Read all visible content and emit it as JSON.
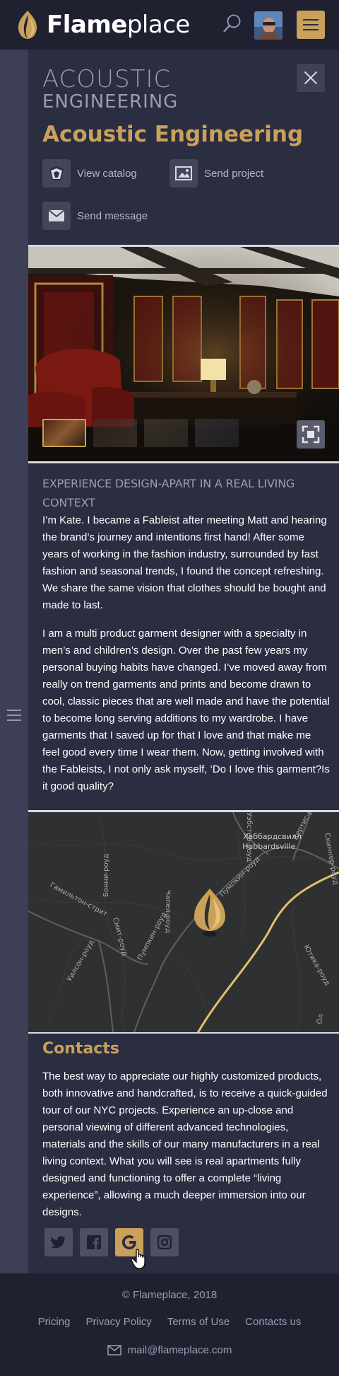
{
  "header": {
    "logo_bold": "Flame",
    "logo_light": "place"
  },
  "panel": {
    "kicker_line1": "ACOUSTIC",
    "kicker_line2": "ENGINEERING",
    "title": "Acoustic Engineering",
    "actions": {
      "catalog": "View catalog",
      "project": "Send project",
      "message": "Send message"
    }
  },
  "experience": {
    "heading": "EXPERIENCE DESIGN-APART IN A REAL LIVING CONTEXT",
    "paragraph1": "I’m Kate. I became a Fableist after meeting Matt and hearing the brand’s journey and intentions first hand! After some years of working in the fashion industry, surrounded by fast fashion and seasonal trends, I found the concept refreshing. We share the same vision that clothes should be bought and made to last.",
    "paragraph2": "I am a multi product garment designer with a specialty in men’s and children’s design. Over the past few years my personal buying habits have changed. I’ve moved away from really on trend garments and prints and become drawn to cool, classic pieces that are well made and have the potential to become long serving additions to my wardrobe. I have garments that I saved up for that I love and that make me feel good every time I wear them. Now, getting involved with the Fableists, I not only ask myself, ‘Do I love this garment?Is it good quality?"
  },
  "map": {
    "labels": {
      "place_ru": "Хаббардсвилл",
      "place_en": "Hubbardsville",
      "street_hamilton": "Гамильтон-стрит",
      "road_pumpkin1": "Пумпкин-роуд",
      "road_pumpkin2": "Пумпкин-роуд",
      "road_curtis": "Кертис-роуд",
      "road_bonnie": "Бонни-роуд",
      "road_smith": "Смит-роуд",
      "road_chapel": "Чапел-роуд",
      "road_wilson": "Уилсон-роуд",
      "road_utica": "Ютика-роуд",
      "road_webster": "Уэбстер-роуд",
      "road_cooper": "Купер",
      "road_skinner": "Скиннер-роуд",
      "road_edge": "Ол"
    }
  },
  "contacts": {
    "title": "Contacts",
    "text": "The best way to appreciate our highly customized products, both innovative and handcrafted, is to receive a quick-guided tour of our NYC projects. Experience an up-close and personal viewing of different advanced technologies, materials and the skills of our many manufacturers in a real living context. What you will see is real apartments fully designed and functioning to offer a complete “living experience”, allowing a much deeper immersion into our designs.",
    "socials": [
      "twitter-icon",
      "facebook-icon",
      "google-icon",
      "instagram-icon"
    ]
  },
  "footer": {
    "copyright": "© Flameplace, 2018",
    "links": [
      "Pricing",
      "Privacy Policy",
      "Terms of Use",
      "Contacts us"
    ],
    "email": "mail@flameplace.com"
  },
  "colors": {
    "accent": "#c9a15b",
    "background": "#2b2d40",
    "header": "#1f2131"
  }
}
